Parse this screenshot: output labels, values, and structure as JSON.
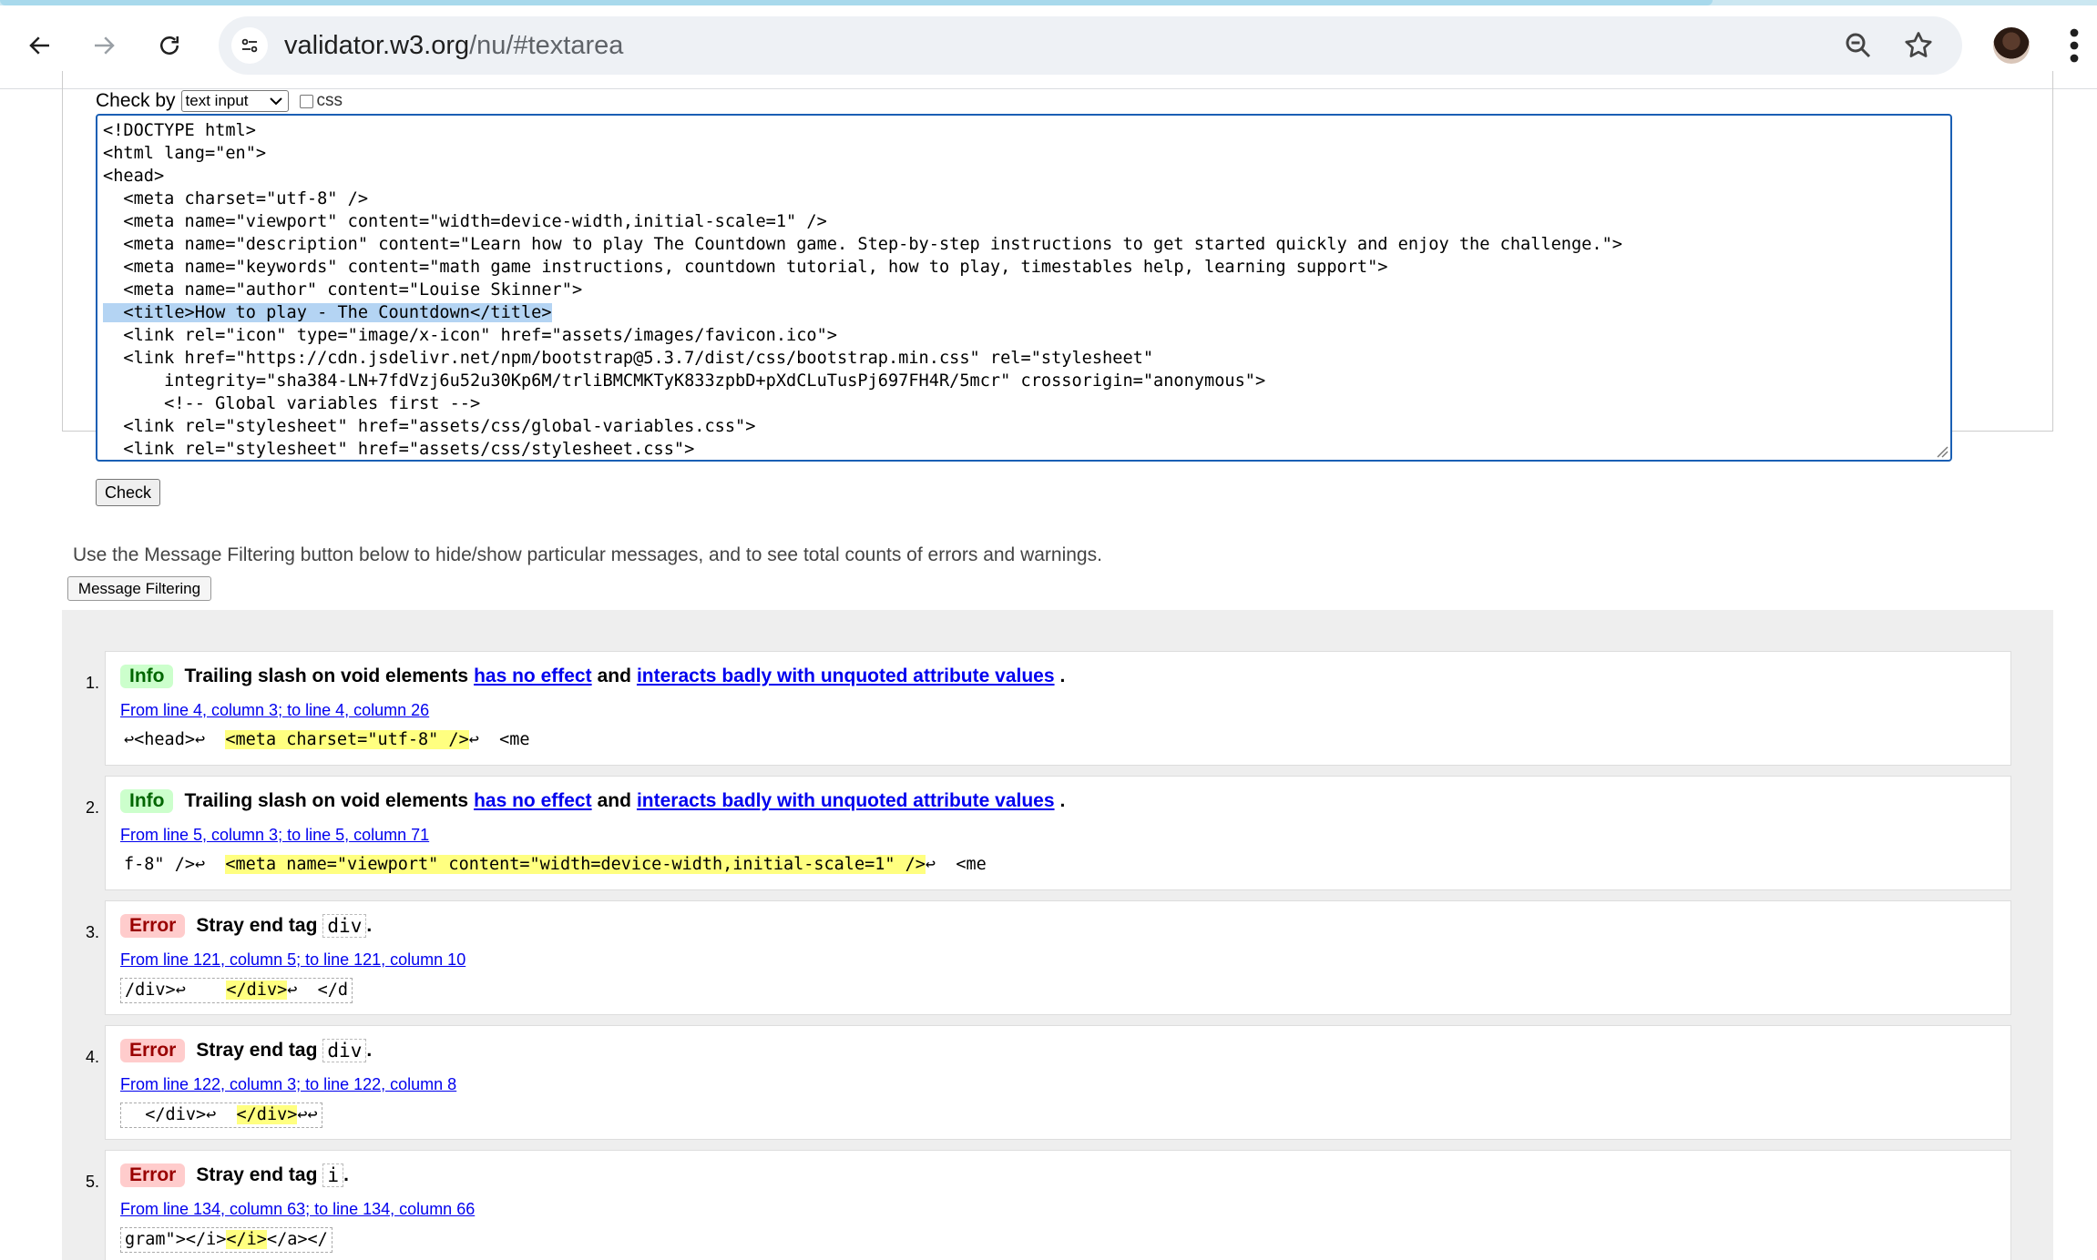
{
  "browser": {
    "url_host": "validator.w3.org",
    "url_path": "/nu/#textarea"
  },
  "form": {
    "check_by_label": "Check by",
    "check_by_value": "text input",
    "css_label": "css",
    "check_button": "Check",
    "source_lines": [
      "<!DOCTYPE html>",
      "<html lang=\"en\">",
      "<head>",
      "  <meta charset=\"utf-8\" />",
      "  <meta name=\"viewport\" content=\"width=device-width,initial-scale=1\" />",
      "  <meta name=\"description\" content=\"Learn how to play The Countdown game. Step-by-step instructions to get started quickly and enjoy the challenge.\">",
      "  <meta name=\"keywords\" content=\"math game instructions, countdown tutorial, how to play, timestables help, learning support\">",
      "  <meta name=\"author\" content=\"Louise Skinner\">",
      "  <title>How to play - The Countdown</title>",
      "  <link rel=\"icon\" type=\"image/x-icon\" href=\"assets/images/favicon.ico\">",
      "  <link href=\"https://cdn.jsdelivr.net/npm/bootstrap@5.3.7/dist/css/bootstrap.min.css\" rel=\"stylesheet\"",
      "      integrity=\"sha384-LN+7fdVzj6u52u30Kp6M/trliBMCMKTyK833zpbD+pXdCLuTusPj697FH4R/5mcr\" crossorigin=\"anonymous\">",
      "      <!-- Global variables first -->",
      "  <link rel=\"stylesheet\" href=\"assets/css/global-variables.css\">",
      "  <link rel=\"stylesheet\" href=\"assets/css/stylesheet.css\">"
    ]
  },
  "filtering": {
    "hint": "Use the Message Filtering button below to hide/show particular messages, and to see total counts of errors and warnings.",
    "button": "Message Filtering"
  },
  "messages": [
    {
      "num": "1.",
      "type": "Info",
      "text": "Trailing slash on void elements",
      "link1": "has no effect",
      "and": "and",
      "link2": "interacts badly with unquoted attribute values",
      "end": ".",
      "location": "From line 4, column 3; to line 4, column 26",
      "extract_pre": "↩<head>↩  ",
      "extract_hl": "<meta charset=\"utf-8\" />",
      "extract_post": "↩  <me"
    },
    {
      "num": "2.",
      "type": "Info",
      "text": "Trailing slash on void elements",
      "link1": "has no effect",
      "and": "and",
      "link2": "interacts badly with unquoted attribute values",
      "end": ".",
      "location": "From line 5, column 3; to line 5, column 71",
      "extract_pre": "f-8\" />↩  ",
      "extract_hl": "<meta name=\"viewport\" content=\"width=device-width,initial-scale=1\" />",
      "extract_post": "↩  <me"
    },
    {
      "num": "3.",
      "type": "Error",
      "text": "Stray end tag",
      "tag": "div",
      "end": ".",
      "location": "From line 121, column 5; to line 121, column 10",
      "extract_pre": "/div>↩    ",
      "extract_hl": "</div>",
      "extract_post": "↩  </d"
    },
    {
      "num": "4.",
      "type": "Error",
      "text": "Stray end tag",
      "tag": "div",
      "end": ".",
      "location": "From line 122, column 3; to line 122, column 8",
      "extract_pre": "  </div>↩  ",
      "extract_hl": "</div>",
      "extract_post": "↩↩"
    },
    {
      "num": "5.",
      "type": "Error",
      "text": "Stray end tag",
      "tag": "i",
      "end": ".",
      "location": "From line 134, column 63; to line 134, column 66",
      "extract_pre": "gram\"></i>",
      "extract_hl": "</i>",
      "extract_post": "</a></"
    }
  ],
  "colors": {
    "info_badge_bg": "#ccffcc",
    "error_badge_bg": "#ffcccc",
    "highlight": "#ffff80",
    "textarea_focus": "#1a5fb4",
    "selection": "#b4d4f3"
  }
}
